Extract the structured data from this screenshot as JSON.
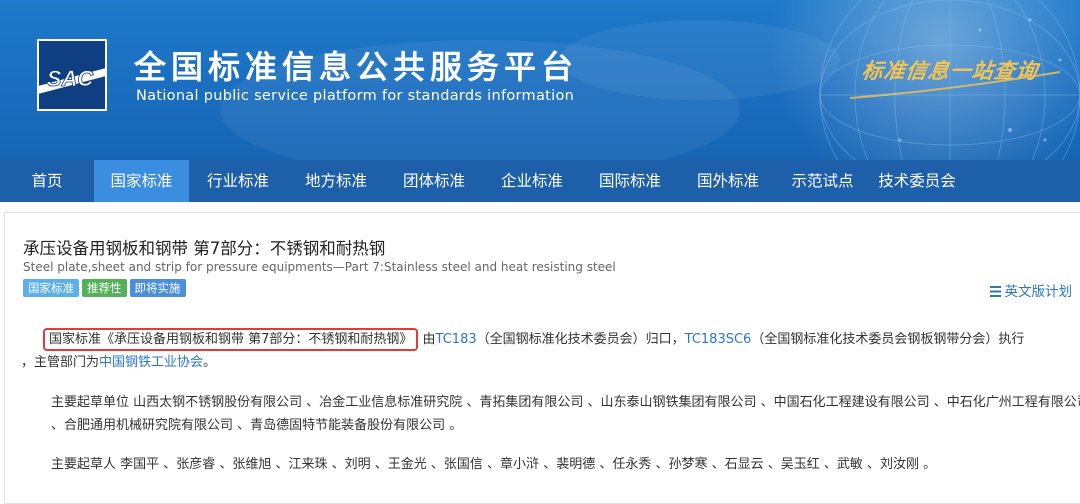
{
  "header": {
    "logo_text": "SAC",
    "title_cn": "全国标准信息公共服务平台",
    "title_en": "National public service platform  for standards information",
    "slogan": "标准信息一站查询"
  },
  "nav": {
    "items": [
      "首页",
      "国家标准",
      "行业标准",
      "地方标准",
      "团体标准",
      "企业标准",
      "国际标准",
      "国外标准",
      "示范试点",
      "技术委员会"
    ],
    "active": "国家标准"
  },
  "standard": {
    "title": "承压设备用钢板和钢带 第7部分：不锈钢和耐热钢",
    "title_en": "Steel plate,sheet and strip for pressure equipments—Part 7:Stainless steel and heat resisting steel",
    "tags": [
      "国家标准",
      "推荐性",
      "即将实施"
    ],
    "plan_link": "英文版计划"
  },
  "body": {
    "p1": {
      "highlighted": "国家标准《承压设备用钢板和钢带 第7部分：不锈钢和耐热钢》",
      "t1": " 由",
      "link1": "TC183",
      "t2": "（全国钢标准化技术委员会）归口，",
      "link2": "TC183SC6",
      "t3": "（全国钢标准化技术委员会钢板钢带分会）执行",
      "t4": "，主管部门为",
      "link3": "中国钢铁工业协会",
      "t5": "。"
    },
    "p2": "主要起草单位 山西太钢不锈钢股份有限公司 、冶金工业信息标准研究院 、青拓集团有限公司 、山东泰山钢铁集团有限公司 、中国石化工程建设有限公司 、中石化广州工程有限公司 、合肥通用机械研究院有限公司 、青岛德固特节能装备股份有限公司 。",
    "p3": "主要起草人 李国平 、张彦睿 、张维旭 、江来珠 、刘明 、王金光 、张国信 、章小浒 、裴明德 、任永秀 、孙梦寒 、石显云 、吴玉红 、武敏 、刘汝刚 。"
  },
  "colors": {
    "banner": "#1b6ec0",
    "nav": "#1e5faa",
    "nav_active": "#3b8de0",
    "link": "#2a78c4",
    "highlight_box": "#e23b3b",
    "tag_national": "#5cb0e8",
    "tag_recommended": "#55b05a",
    "tag_upcoming": "#4a8fd8"
  }
}
